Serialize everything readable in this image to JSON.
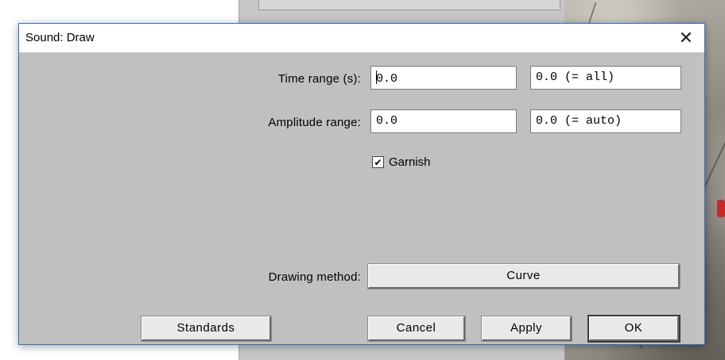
{
  "dialog": {
    "title": "Sound: Draw",
    "close_glyph": "✕"
  },
  "form": {
    "time_range": {
      "label": "Time range (s):",
      "from_value": "0.0",
      "to_value": "0.0 (= all)"
    },
    "amplitude_range": {
      "label": "Amplitude range:",
      "from_value": "0.0",
      "to_value": "0.0 (= auto)"
    },
    "garnish": {
      "label": "Garnish",
      "checked": true,
      "check_glyph": "✔"
    },
    "drawing_method": {
      "label": "Drawing method:",
      "selected": "Curve"
    }
  },
  "buttons": {
    "standards": "Standards",
    "cancel": "Cancel",
    "apply": "Apply",
    "ok": "OK"
  },
  "icons": {
    "close": "close-icon",
    "check": "checkmark-icon"
  }
}
